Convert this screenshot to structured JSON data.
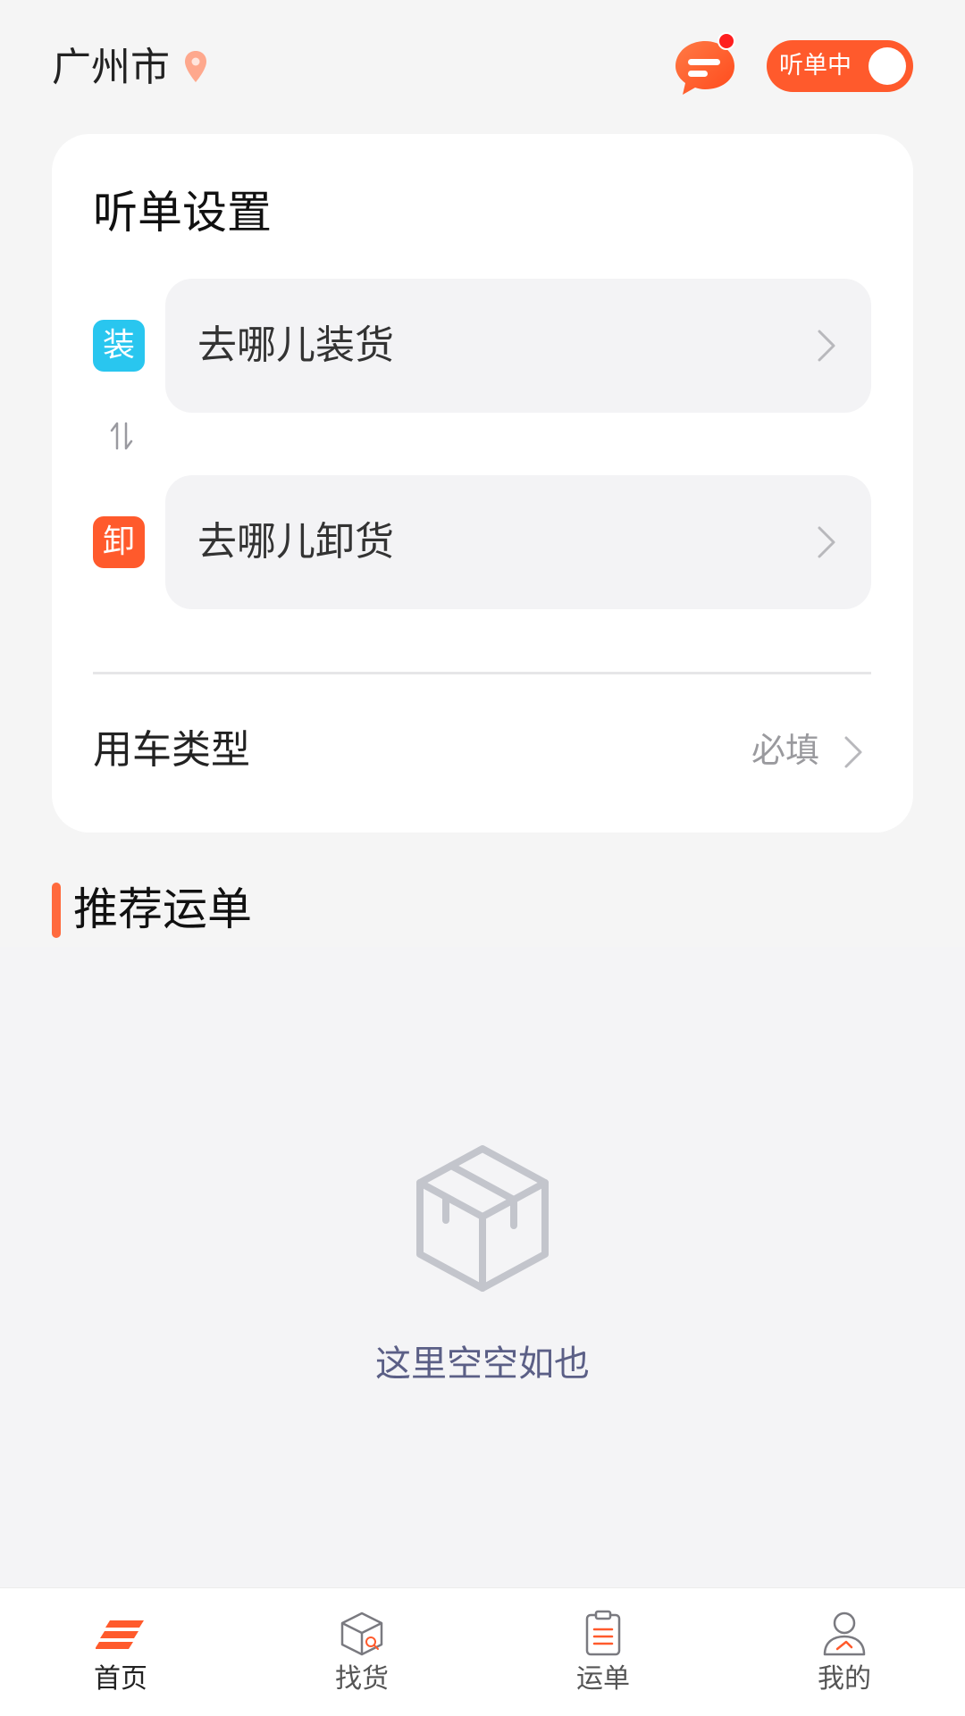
{
  "header": {
    "city": "广州市",
    "listen_toggle_label": "听单中"
  },
  "listen_settings": {
    "title": "听单设置",
    "load_badge": "装",
    "load_placeholder": "去哪儿装货",
    "unload_badge": "卸",
    "unload_placeholder": "去哪儿卸货",
    "vehicle_type_label": "用车类型",
    "vehicle_type_value": "必填"
  },
  "recommended": {
    "title": "推荐运单",
    "empty_text": "这里空空如也"
  },
  "bottom_nav": {
    "items": [
      {
        "label": "首页",
        "icon": "home-icon"
      },
      {
        "label": "找货",
        "icon": "find-cargo-icon"
      },
      {
        "label": "运单",
        "icon": "waybill-icon"
      },
      {
        "label": "我的",
        "icon": "profile-icon"
      }
    ]
  },
  "colors": {
    "accent": "#ff5a2c",
    "load_badge": "#29c6ef",
    "background": "#f4f4f6"
  }
}
